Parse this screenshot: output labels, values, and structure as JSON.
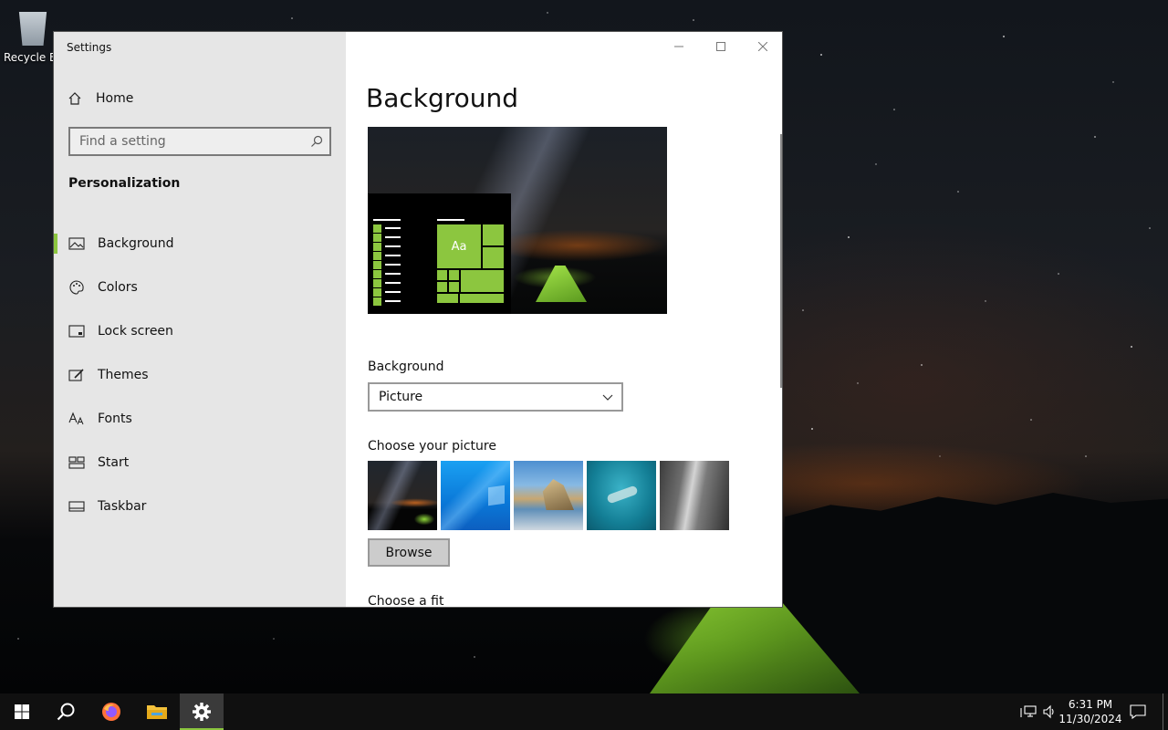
{
  "desktop": {
    "recycle_bin_label": "Recycle Bin"
  },
  "window": {
    "title": "Settings",
    "controls": [
      "minimize-icon",
      "maximize-icon",
      "close-icon"
    ]
  },
  "sidebar": {
    "home_label": "Home",
    "search_placeholder": "Find a setting",
    "section_title": "Personalization",
    "items": [
      {
        "label": "Background",
        "icon": "picture-icon",
        "selected": true
      },
      {
        "label": "Colors",
        "icon": "palette-icon",
        "selected": false
      },
      {
        "label": "Lock screen",
        "icon": "lock-screen-icon",
        "selected": false
      },
      {
        "label": "Themes",
        "icon": "themes-icon",
        "selected": false
      },
      {
        "label": "Fonts",
        "icon": "fonts-icon",
        "selected": false
      },
      {
        "label": "Start",
        "icon": "start-icon",
        "selected": false
      },
      {
        "label": "Taskbar",
        "icon": "taskbar-icon",
        "selected": false
      }
    ]
  },
  "content": {
    "page_title": "Background",
    "preview_tile_text": "Aa",
    "background_label": "Background",
    "background_value": "Picture",
    "choose_picture_label": "Choose your picture",
    "browse_label": "Browse",
    "choose_fit_label": "Choose a fit"
  },
  "taskbar": {
    "items": [
      "start-icon",
      "search-icon",
      "firefox-icon",
      "file-explorer-icon",
      "settings-icon"
    ],
    "time": "6:31 PM",
    "date": "11/30/2024"
  },
  "colors": {
    "accent": "#8cc63f",
    "sidebar_bg": "#e6e6e6",
    "taskbar_bg": "#101010"
  }
}
